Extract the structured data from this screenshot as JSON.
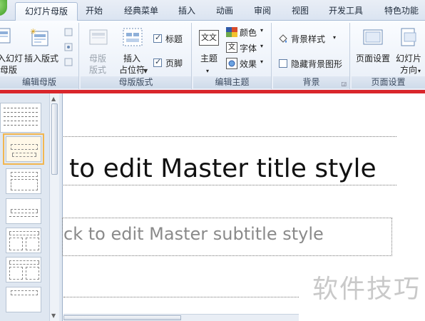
{
  "tabs": [
    {
      "label": "幻灯片母版",
      "active": true
    },
    {
      "label": "开始"
    },
    {
      "label": "经典菜单"
    },
    {
      "label": "插入"
    },
    {
      "label": "动画"
    },
    {
      "label": "审阅"
    },
    {
      "label": "视图"
    },
    {
      "label": "开发工具"
    },
    {
      "label": "特色功能"
    }
  ],
  "ribbon": {
    "group_edit_master": {
      "label": "编辑母版",
      "insert_slide_master": {
        "line1": "入幻灯",
        "line2": "母版"
      },
      "insert_layout": "插入版式"
    },
    "group_master_layout": {
      "label": "母版版式",
      "master_layout": {
        "line1": "母版",
        "line2": "版式"
      },
      "insert_placeholder": {
        "line1": "插入",
        "line2": "占位符"
      },
      "title_checkbox": "标题",
      "footer_checkbox": "页脚",
      "title_checked": true,
      "footer_checked": true
    },
    "group_edit_theme": {
      "label": "编辑主题",
      "themes": "主题",
      "theme_icon_text": "文文",
      "colors": "颜色",
      "fonts": "字体",
      "fonts_icon_text": "文",
      "effects": "效果"
    },
    "group_background": {
      "label": "背景",
      "background_styles": "背景样式",
      "hide_background": "隐藏背景图形",
      "hide_background_checked": false
    },
    "group_page_setup": {
      "label": "页面设置",
      "page_setup": "页面设置",
      "slide_orientation": {
        "line1": "幻灯片",
        "line2": "方向"
      }
    }
  },
  "slide": {
    "title": "to edit Master title style",
    "subtitle": "ck to edit Master subtitle style"
  },
  "watermark": "软件技巧",
  "colors": {
    "accent_red_line": "#d9262b",
    "ribbon_bg": "#e8eef7",
    "pane_bg": "#dfe7f1",
    "selected_thumb": "#f2b64f"
  }
}
